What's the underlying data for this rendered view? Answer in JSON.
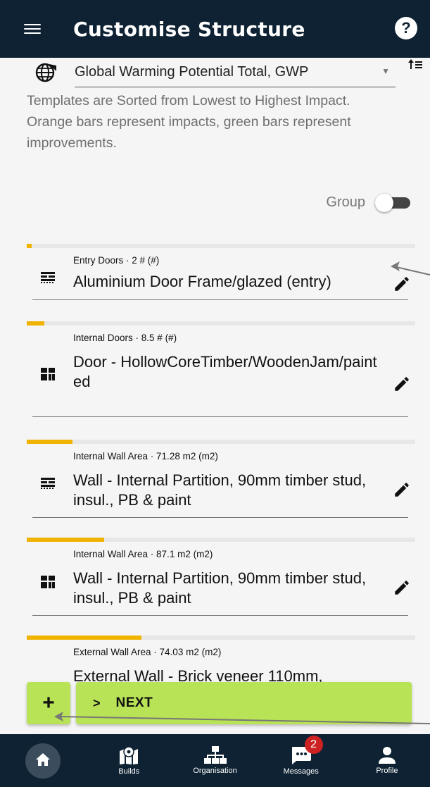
{
  "header": {
    "title": "Customise Structure",
    "help_label": "?"
  },
  "metric": {
    "label": "Global Warming Potential Total, GWP",
    "sort_icon": "sort-ascending-icon"
  },
  "info": {
    "line1": "Templates are Sorted from Lowest to Highest Impact.",
    "line2": "Orange bars represent impacts, green bars represent improvements."
  },
  "group": {
    "label": "Group",
    "enabled": false
  },
  "colors": {
    "appbar": "#0e2233",
    "impact_bar": "#f0b400",
    "accent_green": "#b8e356",
    "badge": "#cc2222"
  },
  "items": [
    {
      "meta": "Entry Doors · 2 # (#)",
      "name": "Aluminium Door Frame/glazed (entry)",
      "impact": 0.013,
      "icon": "wall-pattern-icon"
    },
    {
      "meta": "Internal Doors · 8.5 # (#)",
      "name": "Door - HollowCoreTimber/WoodenJam/painted",
      "impact": 0.045,
      "icon": "grid-block-icon"
    },
    {
      "meta": "Internal Wall Area · 71.28 m2 (m2)",
      "name": "Wall - Internal Partition, 90mm timber stud, insul., PB & paint",
      "impact": 0.118,
      "icon": "wall-pattern-icon"
    },
    {
      "meta": "Internal Wall Area · 87.1 m2 (m2)",
      "name": "Wall - Internal Partition, 90mm timber stud, insul., PB & paint",
      "impact": 0.2,
      "icon": "grid-block-icon"
    },
    {
      "meta": "External Wall Area · 74.03 m2 (m2)",
      "name": "External Wall - Brick veneer 110mm,",
      "impact": 0.295,
      "icon": "wall-pattern-icon"
    }
  ],
  "actions": {
    "add_label": "+",
    "next_chevron": ">",
    "next_label": "NEXT"
  },
  "nav": [
    {
      "label": "",
      "icon": "home-icon",
      "active": true
    },
    {
      "label": "Builds",
      "icon": "map-pin-icon"
    },
    {
      "label": "Organisation",
      "icon": "org-chart-icon"
    },
    {
      "label": "Messages",
      "icon": "chat-icon",
      "badge": "2"
    },
    {
      "label": "Profile",
      "icon": "person-icon"
    }
  ]
}
